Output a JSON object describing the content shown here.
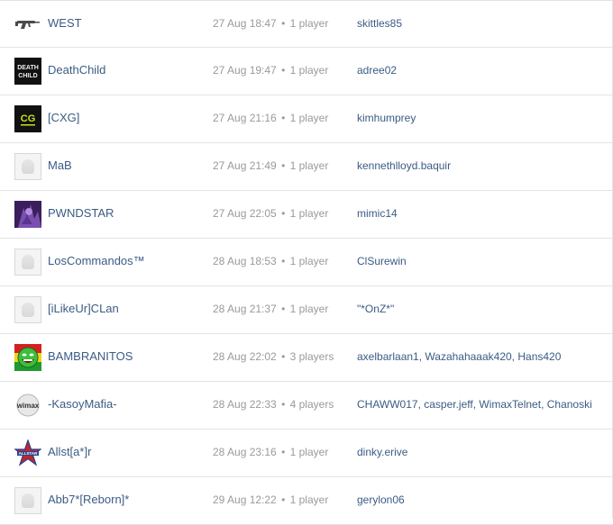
{
  "clans": [
    {
      "name": "WEST",
      "date": "27 Aug 18:47",
      "players": "1 player",
      "members": "skittles85",
      "avatar": "gun-icon"
    },
    {
      "name": "DeathChild",
      "date": "27 Aug 19:47",
      "players": "1 player",
      "members": "adree02",
      "avatar": "deathchild-logo"
    },
    {
      "name": "[CXG]",
      "date": "27 Aug 21:16",
      "players": "1 player",
      "members": "kimhumprey",
      "avatar": "cxg-logo"
    },
    {
      "name": "MaB",
      "date": "27 Aug 21:49",
      "players": "1 player",
      "members": "kennethlloyd.baquir",
      "avatar": "default-avatar"
    },
    {
      "name": "PWNDSTAR",
      "date": "27 Aug 22:05",
      "players": "1 player",
      "members": "mimic14",
      "avatar": "pwndstar-avatar"
    },
    {
      "name": "LosCommandos™",
      "date": "28 Aug 18:53",
      "players": "1 player",
      "members": "ClSurewin",
      "avatar": "default-avatar"
    },
    {
      "name": "[iLikeUr]CLan",
      "date": "28 Aug 21:37",
      "players": "1 player",
      "members": "\"*OnZ*\"",
      "avatar": "default-avatar"
    },
    {
      "name": "BAMBRANITOS",
      "date": "28 Aug 22:02",
      "players": "3 players",
      "members": "axelbarlaan1, Wazahahaaak420, Hans420",
      "avatar": "rasta-face-avatar"
    },
    {
      "name": "-KasoyMafia-",
      "date": "28 Aug 22:33",
      "players": "4 players",
      "members": "CHAWW017, casper.jeff, WimaxTelnet, Chanoski",
      "avatar": "wimax-logo"
    },
    {
      "name": "Allst[a*]r",
      "date": "28 Aug 23:16",
      "players": "1 player",
      "members": "dinky.erive",
      "avatar": "allstar-logo"
    },
    {
      "name": "Abb7*[Reborn]*",
      "date": "29 Aug 12:22",
      "players": "1 player",
      "members": "gerylon06",
      "avatar": "default-avatar"
    }
  ],
  "separator": "•",
  "avatar_labels": {
    "deathchild": "DEATH CHILD",
    "cxg": "CXG",
    "wimax": "wimax",
    "allstar": "ALLSTAR"
  }
}
